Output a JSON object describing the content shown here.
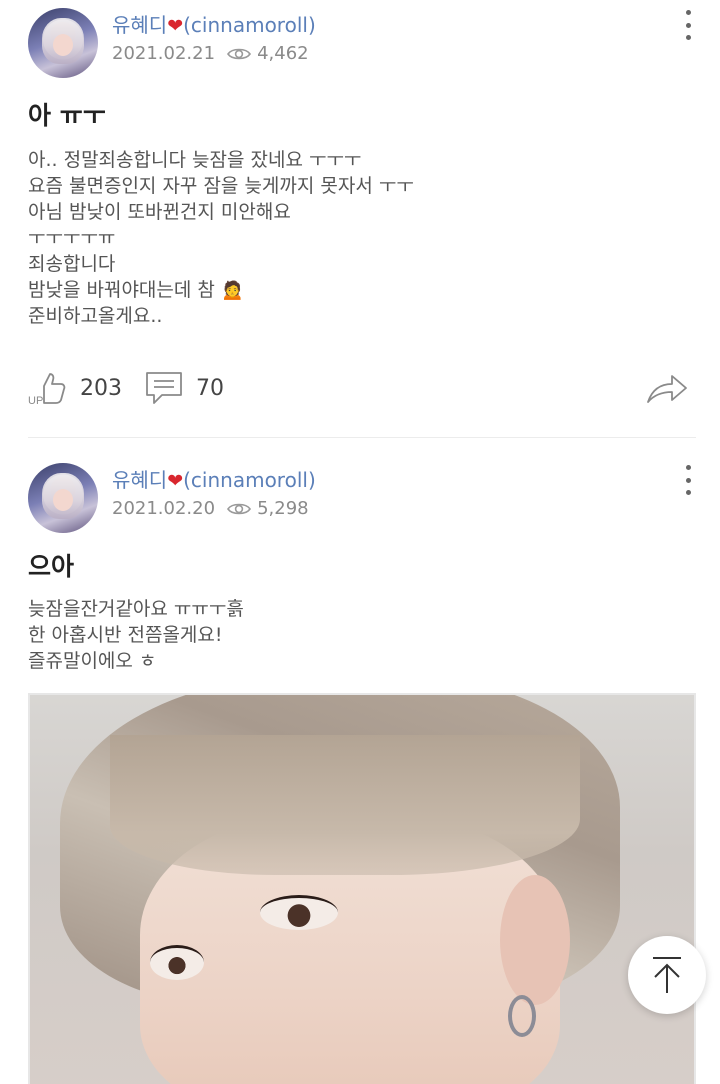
{
  "posts": [
    {
      "author": "유혜디",
      "username": "(cinnamoroll)",
      "date": "2021.02.21",
      "views": "4,462",
      "title": "아 ㅠㅜ",
      "body": [
        "아.. 정말죄송합니다 늦잠을 잤네요 ㅜㅜㅜ",
        "요즘 불면증인지 자꾸 잠을 늦게까지 못자서 ㅜㅜ",
        "아님 밤낮이 또바뀐건지 미안해요",
        "ㅜㅜㅜㅜㅠ",
        "죄송합니다",
        "밤낮을 바꿔야대는데 참 🙍",
        "준비하고올게요.."
      ],
      "likes": "203",
      "like_badge": "UP",
      "comments": "70"
    },
    {
      "author": "유혜디",
      "username": "(cinnamoroll)",
      "date": "2021.02.20",
      "views": "5,298",
      "title": "으아",
      "body": [
        "늦잠을잔거같아요 ㅠㅠㅜ흙",
        "한 아홉시반 전쯤올게요!",
        "즐쥬말이에오 ㅎ"
      ]
    }
  ],
  "icons": {
    "more": "more-vertical-icon",
    "views": "eye-icon",
    "like": "thumbs-up-icon",
    "comment": "comment-icon",
    "share": "share-icon",
    "scroll_top": "arrow-up-icon"
  },
  "colors": {
    "author": "#5b7fb8",
    "heart": "#d9262e",
    "meta": "#8a8a8a",
    "title": "#222222",
    "body": "#555555"
  }
}
